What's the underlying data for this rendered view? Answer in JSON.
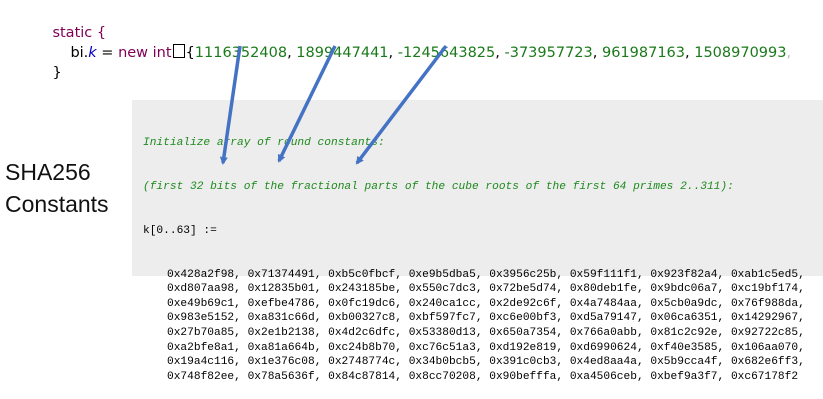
{
  "java_code": {
    "line1": "static {",
    "field_receiver": "bi.",
    "field_name": "k",
    "assign": " = ",
    "new_keyword": "new",
    "type_keyword": "int",
    "brace_open": "{",
    "values": [
      "1116352408",
      "1899447441",
      "-1245643825",
      "-373957723",
      "961987163",
      "1508970993"
    ],
    "separator": ", ",
    "trailing": ",",
    "line3": "}"
  },
  "pseudocode": {
    "comment_line1": "Initialize array of round constants:",
    "comment_line2": "(first 32 bits of the fractional parts of the cube roots of the first 64 primes 2..311):",
    "declaration": "k[0..63] :=",
    "constant_rows": [
      "0x428a2f98, 0x71374491, 0xb5c0fbcf, 0xe9b5dba5, 0x3956c25b, 0x59f111f1, 0x923f82a4, 0xab1c5ed5,",
      "0xd807aa98, 0x12835b01, 0x243185be, 0x550c7dc3, 0x72be5d74, 0x80deb1fe, 0x9bdc06a7, 0xc19bf174,",
      "0xe49b69c1, 0xefbe4786, 0x0fc19dc6, 0x240ca1cc, 0x2de92c6f, 0x4a7484aa, 0x5cb0a9dc, 0x76f988da,",
      "0x983e5152, 0xa831c66d, 0xb00327c8, 0xbf597fc7, 0xc6e00bf3, 0xd5a79147, 0x06ca6351, 0x14292967,",
      "0x27b70a85, 0x2e1b2138, 0x4d2c6dfc, 0x53380d13, 0x650a7354, 0x766a0abb, 0x81c2c92e, 0x92722c85,",
      "0xa2bfe8a1, 0xa81a664b, 0xc24b8b70, 0xc76c51a3, 0xd192e819, 0xd6990624, 0xf40e3585, 0x106aa070,",
      "0x19a4c116, 0x1e376c08, 0x2748774c, 0x34b0bcb5, 0x391c0cb3, 0x4ed8aa4a, 0x5b9cca4f, 0x682e6ff3,",
      "0x748f82ee, 0x78a5636f, 0x84c87814, 0x8cc70208, 0x90befffa, 0xa4506ceb, 0xbef9a3f7, 0xc67178f2"
    ]
  },
  "side_label": {
    "line1": "SHA256",
    "line2": "Constants"
  },
  "colors": {
    "keyword": "#7f0055",
    "field": "#0000c0",
    "number": "#1a7a1a",
    "comment": "#1e8a1e",
    "panel": "#ededed",
    "arrow": "#4472c4"
  }
}
